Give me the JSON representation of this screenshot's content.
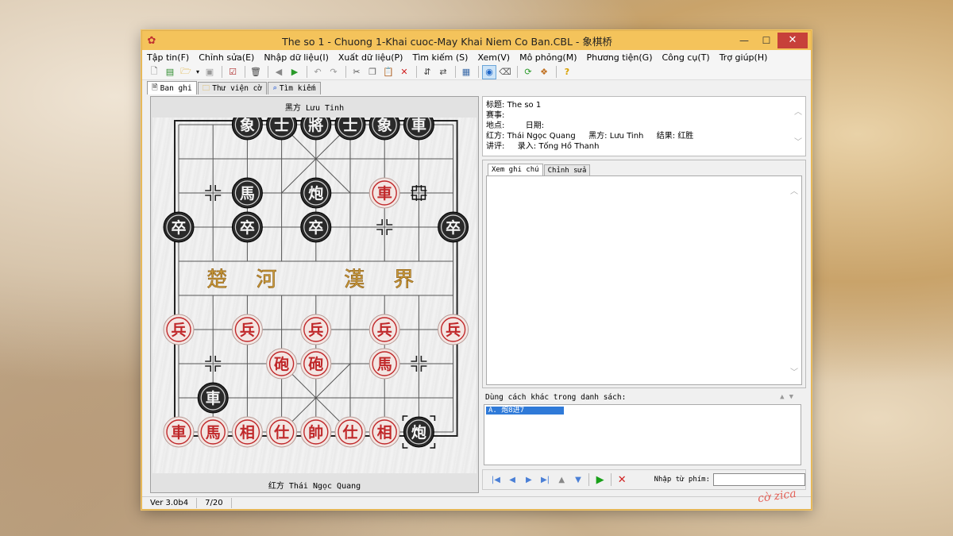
{
  "window": {
    "title": "The so 1 - Chuong 1-Khai cuoc-May Khai Niem Co Ban.CBL - 象棋桥",
    "minimize": "—",
    "maximize": "☐",
    "close": "✕",
    "icon": "flower-icon"
  },
  "menu": [
    "Tập tin(F)",
    "Chỉnh sửa(E)",
    "Nhập dữ liệu(I)",
    "Xuất dữ liệu(P)",
    "Tìm kiếm (S)",
    "Xem(V)",
    "Mô phỏng(M)",
    "Phương tiện(G)",
    "Công cụ(T)",
    "Trợ giúp(H)"
  ],
  "toolbar_icons": [
    "new-file-icon",
    "open-list-icon",
    "open-folder-icon",
    "dropdown-icon",
    "save-icon",
    "edit-icon",
    "delete-icon",
    "back-icon",
    "forward-icon",
    "undo-icon",
    "redo-icon",
    "cut-icon",
    "copy-icon",
    "paste-icon",
    "remove-icon",
    "flip-vertical-icon",
    "swap-icon",
    "board-icon",
    "engine-icon",
    "eraser-icon",
    "refresh-icon",
    "analysis-icon",
    "help-icon"
  ],
  "tabs": [
    {
      "label": "Ban ghi",
      "icon": "document-icon"
    },
    {
      "label": "Thư viện cờ",
      "icon": "folder-icon"
    },
    {
      "label": "Tìm kiếm",
      "icon": "magnifier-icon"
    }
  ],
  "board": {
    "top_player": "黑方 Lưu Tinh",
    "bottom_player": "红方 Thái Ngọc Quang",
    "river_left": "楚 河",
    "river_right": "漢 界",
    "pieces": [
      {
        "ch": "象",
        "side": "black",
        "col": 2,
        "row": 0
      },
      {
        "ch": "士",
        "side": "black",
        "col": 3,
        "row": 0
      },
      {
        "ch": "將",
        "side": "black",
        "col": 4,
        "row": 0
      },
      {
        "ch": "士",
        "side": "black",
        "col": 5,
        "row": 0
      },
      {
        "ch": "象",
        "side": "black",
        "col": 6,
        "row": 0
      },
      {
        "ch": "車",
        "side": "black",
        "col": 7,
        "row": 0
      },
      {
        "ch": "馬",
        "side": "black",
        "col": 2,
        "row": 2
      },
      {
        "ch": "炮",
        "side": "black",
        "col": 4,
        "row": 2
      },
      {
        "ch": "車",
        "side": "red",
        "col": 6,
        "row": 2
      },
      {
        "ch": "卒",
        "side": "black",
        "col": 0,
        "row": 3
      },
      {
        "ch": "卒",
        "side": "black",
        "col": 2,
        "row": 3
      },
      {
        "ch": "卒",
        "side": "black",
        "col": 4,
        "row": 3
      },
      {
        "ch": "卒",
        "side": "black",
        "col": 8,
        "row": 3
      },
      {
        "ch": "兵",
        "side": "red",
        "col": 0,
        "row": 6
      },
      {
        "ch": "兵",
        "side": "red",
        "col": 2,
        "row": 6
      },
      {
        "ch": "兵",
        "side": "red",
        "col": 4,
        "row": 6
      },
      {
        "ch": "兵",
        "side": "red",
        "col": 6,
        "row": 6
      },
      {
        "ch": "兵",
        "side": "red",
        "col": 8,
        "row": 6
      },
      {
        "ch": "砲",
        "side": "red",
        "col": 3,
        "row": 7
      },
      {
        "ch": "砲",
        "side": "red",
        "col": 4,
        "row": 7
      },
      {
        "ch": "馬",
        "side": "red",
        "col": 6,
        "row": 7
      },
      {
        "ch": "車",
        "side": "black",
        "col": 1,
        "row": 8
      },
      {
        "ch": "車",
        "side": "red",
        "col": 0,
        "row": 9
      },
      {
        "ch": "馬",
        "side": "red",
        "col": 1,
        "row": 9
      },
      {
        "ch": "相",
        "side": "red",
        "col": 2,
        "row": 9
      },
      {
        "ch": "仕",
        "side": "red",
        "col": 3,
        "row": 9
      },
      {
        "ch": "帥",
        "side": "red",
        "col": 4,
        "row": 9
      },
      {
        "ch": "仕",
        "side": "red",
        "col": 5,
        "row": 9
      },
      {
        "ch": "相",
        "side": "red",
        "col": 6,
        "row": 9
      },
      {
        "ch": "炮",
        "side": "black",
        "col": 7,
        "row": 9
      }
    ],
    "last_move_from": {
      "col": 7,
      "row": 2
    },
    "last_move_to": {
      "col": 7,
      "row": 9
    }
  },
  "info": {
    "title_label": "标题:",
    "title_value": "The so 1",
    "event_label": "赛事:",
    "place_label": "地点:",
    "date_label": "日期:",
    "red_label": "红方:",
    "red_value": "Thái Ngọc Quang",
    "black_label": "黑方:",
    "black_value": "Lưu Tinh",
    "result_label": "结果:",
    "result_value": "红胜",
    "commentator_label": "讲评:",
    "recorder_label": "录入:",
    "recorder_value": "Tống Hồ Thanh"
  },
  "notes_tabs": [
    "Xem ghi chú",
    "Chỉnh sửa"
  ],
  "alternatives": {
    "label": "Dùng cách khác trong danh sách:",
    "items": [
      "A. 炮8进7"
    ]
  },
  "nav": {
    "label": "Nhập từ phím:",
    "input_value": "",
    "icons": [
      "first-icon",
      "prev-icon",
      "next-icon",
      "last-icon",
      "up-icon",
      "down-icon",
      "play-icon",
      "stop-icon"
    ]
  },
  "status": {
    "version": "Ver 3.0b4",
    "move": "7/20"
  },
  "watermark": "cờ zica",
  "colors": {
    "titlebar": "#f4c35b",
    "red_piece": "#c0282a",
    "black_piece": "#1c1c1c",
    "selection": "#2f7ad8"
  }
}
